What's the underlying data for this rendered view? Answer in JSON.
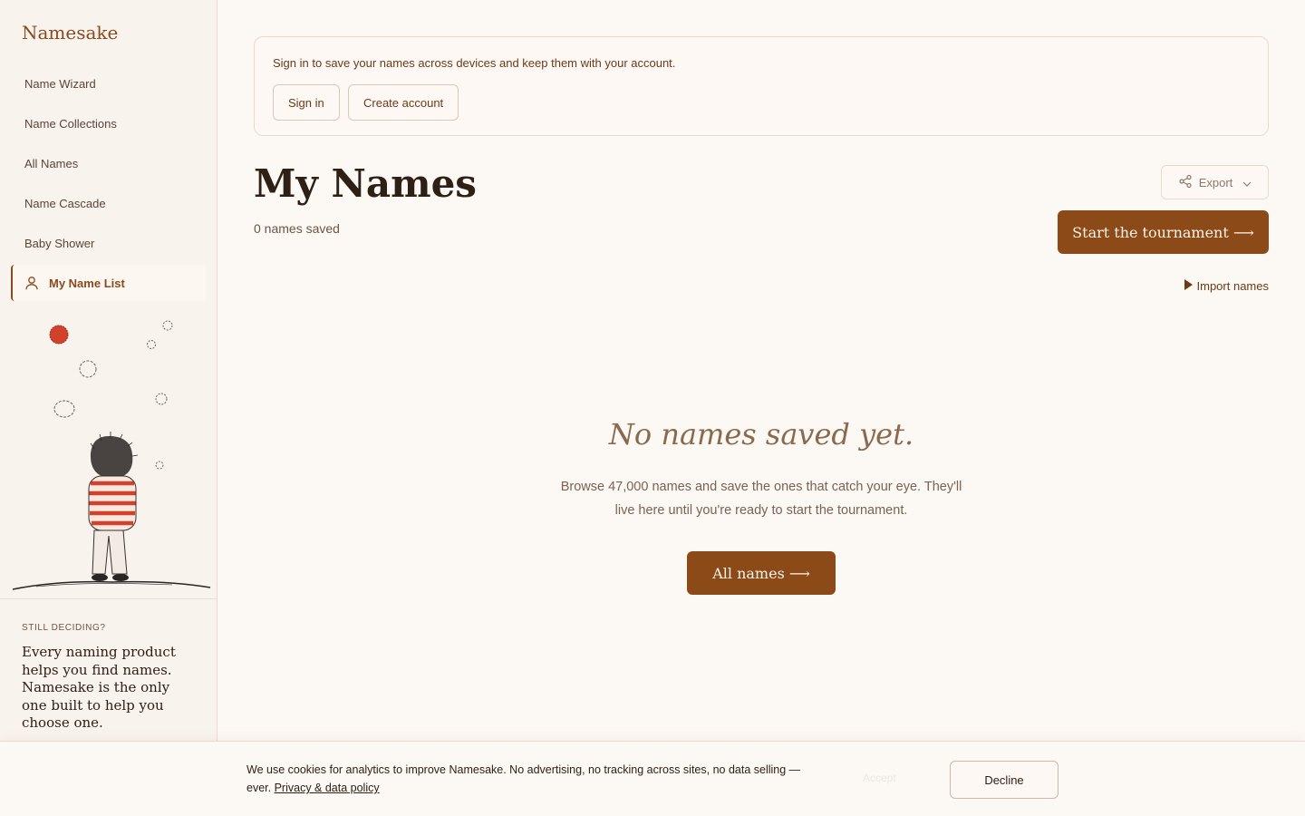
{
  "brand": "Namesake",
  "sidebar": {
    "items": [
      {
        "label": "Name Wizard"
      },
      {
        "label": "Name Collections"
      },
      {
        "label": "All Names"
      },
      {
        "label": "Name Cascade"
      },
      {
        "label": "Baby Shower"
      },
      {
        "label": "My Name List",
        "icon": "user-icon",
        "active": true
      }
    ],
    "footer": {
      "eyebrow": "STILL DECIDING?",
      "quote": "Every naming product helps you find names. Namesake is the only one built to help you choose one."
    }
  },
  "banner": {
    "text": "Sign in to save your names across devices and keep them with your account.",
    "signin": "Sign in",
    "create": "Create account"
  },
  "header": {
    "title": "My Names",
    "count": "0 names saved",
    "export": "Export",
    "tournament": "Start the tournament ⟶",
    "import": "Import names"
  },
  "empty": {
    "title": "No names saved yet.",
    "desc": "Browse 47,000 names and save the ones that catch your eye. They'll live here until you're ready to start the tournament.",
    "button": "All names ⟶"
  },
  "cookie": {
    "text": "We use cookies for analytics to improve Namesake. No advertising, no tracking across sites, no data selling — ever.",
    "link": "Privacy & data policy",
    "accept": "Accept",
    "decline": "Decline"
  },
  "colors": {
    "accent": "#8b4a18",
    "background": "#fcf8f4",
    "sidebar": "#f9f3ee"
  }
}
